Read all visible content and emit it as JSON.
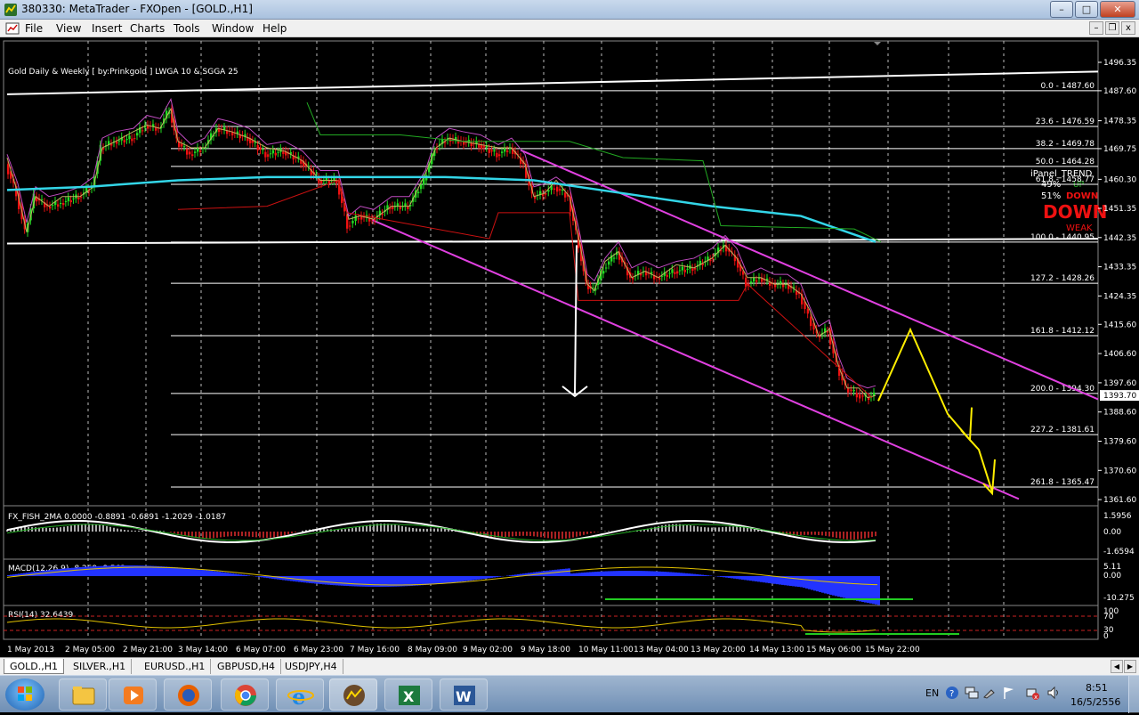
{
  "window": {
    "title": "380330: MetaTrader - FXOpen - [GOLD.,H1]",
    "min_label": "–",
    "max_label": "□",
    "close_label": "✕"
  },
  "menu": {
    "items": [
      "File",
      "View",
      "Insert",
      "Charts",
      "Tools",
      "Window",
      "Help"
    ],
    "mdi_min": "–",
    "mdi_restore": "❐",
    "mdi_close": "x"
  },
  "chart": {
    "header_label": "Gold Daily & Weekly [ by:Prinkgold ] LWGA 10  &  SGGA 25",
    "price_axis": [
      "1496.35",
      "1487.60",
      "1478.35",
      "1469.75",
      "1460.30",
      "1451.35",
      "1442.35",
      "1433.35",
      "1424.35",
      "1415.60",
      "1406.60",
      "1397.60",
      "1388.60",
      "1379.60",
      "1370.60",
      "1361.60"
    ],
    "current_price": "1393.70",
    "fib_levels": [
      {
        "label": "0.0 - 1487.60"
      },
      {
        "label": "23.6 - 1476.59"
      },
      {
        "label": "38.2 - 1469.78"
      },
      {
        "label": "50.0 - 1464.28"
      },
      {
        "label": "61.8 - 1458.77"
      },
      {
        "label": "100.0 - 1440.95"
      },
      {
        "label": "127.2 - 1428.26"
      },
      {
        "label": "161.8 - 1412.12"
      },
      {
        "label": "200.0 - 1394.30"
      },
      {
        "label": "227.2 - 1381.61"
      },
      {
        "label": "261.8 - 1365.47"
      }
    ],
    "ipanel": {
      "title": "iPanel_TREND",
      "pct1": "49%",
      "pct1_label": "UP",
      "pct2": "51%",
      "pct2_label": "DOWN",
      "big_label": "DOWN",
      "strength": "WEAK"
    },
    "fish": {
      "label": "FX_FISH_2MA 0.0000 -0.8891 -0.6891 -1.2029 -1.0187",
      "axis": [
        "1.5956",
        "0.00",
        "-1.6594"
      ]
    },
    "macd": {
      "label": "MACD(12,26,9) -8.269 -8.562",
      "axis": [
        "5.11",
        "0.00",
        "-10.275"
      ]
    },
    "rsi": {
      "label": "RSI(14) 32.6439",
      "axis": [
        "100",
        "70",
        "30",
        "0"
      ]
    },
    "time_axis": [
      "1 May 2013",
      "2 May 05:00",
      "2 May 21:00",
      "3 May 14:00",
      "6 May 07:00",
      "6 May 23:00",
      "7 May 16:00",
      "8 May 09:00",
      "9 May 02:00",
      "9 May 18:00",
      "10 May 11:00",
      "13 May 04:00",
      "13 May 20:00",
      "14 May 13:00",
      "15 May 06:00",
      "15 May 22:00"
    ]
  },
  "tabs": [
    "GOLD.,H1",
    "SILVER.,H1",
    "EURUSD.,H1",
    "GBPUSD,H4",
    "USDJPY,H4"
  ],
  "taskbar": {
    "lang": "EN",
    "time": "8:51",
    "date": "16/5/2556"
  },
  "colors": {
    "bull": "#22dd22",
    "bear": "#ee1111",
    "ma_cyan": "#33d6e8",
    "channel": "#e040e0",
    "projection": "#ffee00",
    "fib": "#ffffff"
  }
}
